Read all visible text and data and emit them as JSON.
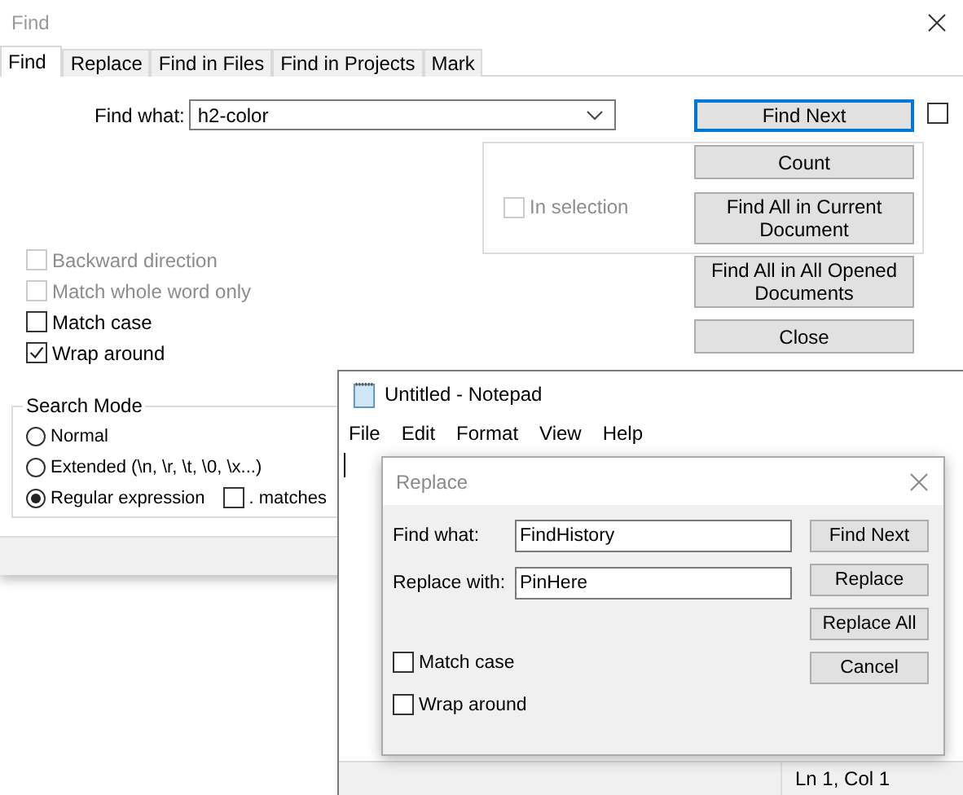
{
  "find_dialog": {
    "title": "Find",
    "tabs": [
      {
        "label": "Find",
        "selected": true
      },
      {
        "label": "Replace",
        "selected": false
      },
      {
        "label": "Find in Files",
        "selected": false
      },
      {
        "label": "Find in Projects",
        "selected": false
      },
      {
        "label": "Mark",
        "selected": false
      }
    ],
    "find_what": {
      "label": "Find what:",
      "value": "h2-color"
    },
    "side_checkbox": {
      "checked": false
    },
    "in_selection": {
      "label": "In selection",
      "checked": false,
      "disabled": true
    },
    "buttons": [
      {
        "label": "Find Next",
        "default": true
      },
      {
        "label": "Count",
        "default": false
      },
      {
        "label": "Find All in Current Document",
        "default": false
      },
      {
        "label": "Find All in All Opened Documents",
        "default": false
      },
      {
        "label": "Close",
        "default": false
      }
    ],
    "options": [
      {
        "label": "Backward direction",
        "checked": false,
        "disabled": true
      },
      {
        "label": "Match whole word only",
        "checked": false,
        "disabled": true
      },
      {
        "label": "Match case",
        "checked": false,
        "disabled": false
      },
      {
        "label": "Wrap around",
        "checked": true,
        "disabled": false
      }
    ],
    "search_mode": {
      "title": "Search Mode",
      "modes": [
        {
          "label": "Normal",
          "selected": false
        },
        {
          "label": "Extended (\\n, \\r, \\t, \\0, \\x...)",
          "selected": false
        },
        {
          "label": "Regular expression",
          "selected": true
        }
      ],
      "dot_option": {
        "label": ". matches",
        "checked": false
      }
    }
  },
  "notepad": {
    "title": "Untitled - Notepad",
    "menu": [
      "File",
      "Edit",
      "Format",
      "View",
      "Help"
    ],
    "status": "Ln 1, Col 1"
  },
  "replace_dialog": {
    "title": "Replace",
    "fields": [
      {
        "label": "Find what:",
        "value": "FindHistory"
      },
      {
        "label": "Replace with:",
        "value": "PinHere"
      }
    ],
    "buttons": [
      "Find Next",
      "Replace",
      "Replace All",
      "Cancel"
    ],
    "options": [
      {
        "label": "Match case",
        "checked": false
      },
      {
        "label": "Wrap around",
        "checked": false
      }
    ]
  }
}
